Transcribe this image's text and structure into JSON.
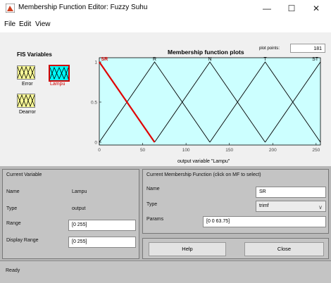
{
  "window": {
    "title": "Membership Function Editor: Fuzzy Suhu",
    "minimize_glyph": "—",
    "maximize_glyph": "☐",
    "close_glyph": "✕"
  },
  "menu": [
    "File",
    "Edit",
    "View"
  ],
  "fis_variables": {
    "title": "FIS Variables",
    "items": [
      {
        "label": "Error",
        "selected": false
      },
      {
        "label": "Lampu",
        "selected": true
      },
      {
        "label": "Dearror",
        "selected": false
      }
    ]
  },
  "plot": {
    "title": "Membership function plots",
    "plot_points_label": "plot points:",
    "plot_points_value": "181",
    "xlabel": "output variable \"Lampu\""
  },
  "chart_data": {
    "type": "line",
    "xlim": [
      0,
      255
    ],
    "ylim": [
      0,
      1
    ],
    "x_ticks": [
      "0",
      "50",
      "100",
      "150",
      "200",
      "250"
    ],
    "y_ticks": [
      "0",
      "0.5",
      "1"
    ],
    "grid": false,
    "series": [
      {
        "name": "SR",
        "x": [
          0,
          0,
          63.75
        ],
        "y": [
          1,
          1,
          0
        ],
        "color": "#e00000",
        "highlight": true
      },
      {
        "name": "R",
        "x": [
          0,
          63.75,
          127.5
        ],
        "y": [
          0,
          1,
          0
        ],
        "color": "#000000"
      },
      {
        "name": "N",
        "x": [
          63.75,
          127.5,
          191.25
        ],
        "y": [
          0,
          1,
          0
        ],
        "color": "#000000"
      },
      {
        "name": "T",
        "x": [
          127.5,
          191.25,
          255
        ],
        "y": [
          0,
          1,
          0
        ],
        "color": "#000000"
      },
      {
        "name": "ST",
        "x": [
          191.25,
          255,
          255
        ],
        "y": [
          0,
          1,
          1
        ],
        "color": "#000000"
      }
    ]
  },
  "current_variable": {
    "title": "Current Variable",
    "name_label": "Name",
    "name_value": "Lampu",
    "type_label": "Type",
    "type_value": "output",
    "range_label": "Range",
    "range_value": "[0 255]",
    "display_range_label": "Display Range",
    "display_range_value": "[0 255]"
  },
  "current_mf": {
    "title": "Current Membership Function (click on MF to select)",
    "name_label": "Name",
    "name_value": "SR",
    "type_label": "Type",
    "type_value": "trimf",
    "params_label": "Params",
    "params_value": "[0 0 63.75]"
  },
  "buttons": {
    "help": "Help",
    "close": "Close"
  },
  "status": "Ready",
  "colors": {
    "plot_bg": "#ccffff",
    "mf_highlight": "#e00000",
    "variable_input": "#ffff99",
    "variable_output": "#00ffff",
    "panel_bg": "#c4c4c4"
  }
}
